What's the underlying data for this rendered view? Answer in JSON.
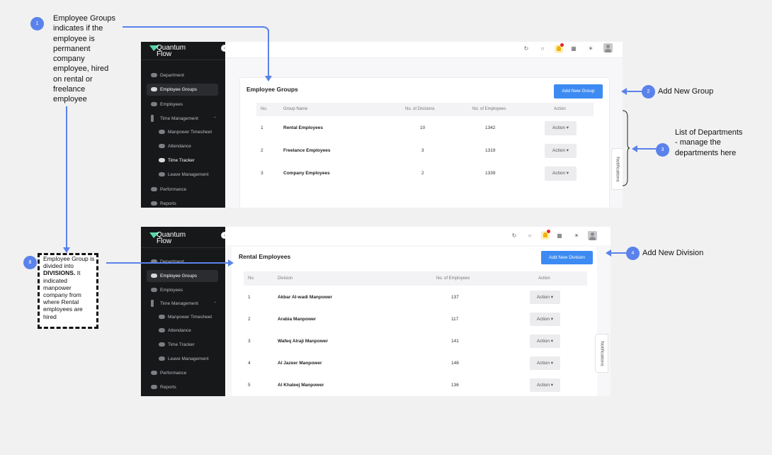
{
  "app": {
    "brand_line1": "Quantum",
    "brand_line2": "Flow",
    "accent": "#3d8bf2",
    "annotation_color": "#5a82ea"
  },
  "sidebar": {
    "items": [
      {
        "label": "Department",
        "icon": "toggle-icon"
      },
      {
        "label": "Employee Groups",
        "icon": "toggle-icon",
        "active": true
      },
      {
        "label": "Employees",
        "icon": "toggle-icon"
      },
      {
        "label": "Time Management",
        "icon": "bar-icon",
        "expanded": true
      },
      {
        "label": "Manpower Timesheet",
        "icon": "toggle-icon"
      },
      {
        "label": "Attendance",
        "icon": "toggle-icon"
      },
      {
        "label": "Time Tracker",
        "icon": "toggle-icon"
      },
      {
        "label": "Leave Management",
        "icon": "toggle-icon"
      },
      {
        "label": "Performance",
        "icon": "toggle-icon"
      },
      {
        "label": "Reports",
        "icon": "toggle-icon"
      }
    ]
  },
  "topbar": {
    "icons": [
      "refresh-icon",
      "search-icon",
      "bell-icon",
      "layout-icon",
      "sun-icon",
      "avatar"
    ]
  },
  "notifications_tab": "Notifications",
  "groups": {
    "title": "Employee Groups",
    "add_button": "Add New Group",
    "columns": [
      "No.",
      "Group Name",
      "No. of Divisions",
      "No. of Employees",
      "Action"
    ],
    "rows": [
      {
        "no": "1",
        "name": "Rental Employees",
        "divisions": "10",
        "employees": "1342",
        "action": "Action ▾"
      },
      {
        "no": "2",
        "name": "Freelance Employees",
        "divisions": "3",
        "employees": "1319",
        "action": "Action ▾"
      },
      {
        "no": "3",
        "name": "Company Employees",
        "divisions": "2",
        "employees": "1339",
        "action": "Action ▾"
      }
    ]
  },
  "divisions": {
    "title": "Rental Employees",
    "add_button": "Add New Division",
    "columns": [
      "No.",
      "Division",
      "No. of Employees",
      "Action"
    ],
    "rows": [
      {
        "no": "1",
        "name": "Akbar Al-wadi Manpower",
        "employees": "137",
        "action": "Action ▾"
      },
      {
        "no": "2",
        "name": "Arabia Manpower",
        "employees": "117",
        "action": "Action ▾"
      },
      {
        "no": "3",
        "name": "Wafeq Alraji Manpower",
        "employees": "141",
        "action": "Action ▾"
      },
      {
        "no": "4",
        "name": "Al Jazeer Manpower",
        "employees": "148",
        "action": "Action ▾"
      },
      {
        "no": "5",
        "name": "Al Khaleej Manpower",
        "employees": "136",
        "action": "Action ▾"
      }
    ]
  },
  "annotations": {
    "a1": {
      "badge": "1",
      "text": "Employee Groups indicates if the employee is permanent company employee, hired on rental or freelance employee"
    },
    "a2": {
      "badge": "2",
      "text": "Add New Group"
    },
    "a3": {
      "badge": "3",
      "text": "List of Departments - manage the departments here"
    },
    "a4": {
      "badge": "4",
      "text": "Add New Division"
    },
    "a8": {
      "badge": "8",
      "text_before": "Employee Group is divided into ",
      "text_bold": "DIVISIONS.",
      "text_after": " It indicated manpower company from where Rental employees are hired"
    }
  }
}
